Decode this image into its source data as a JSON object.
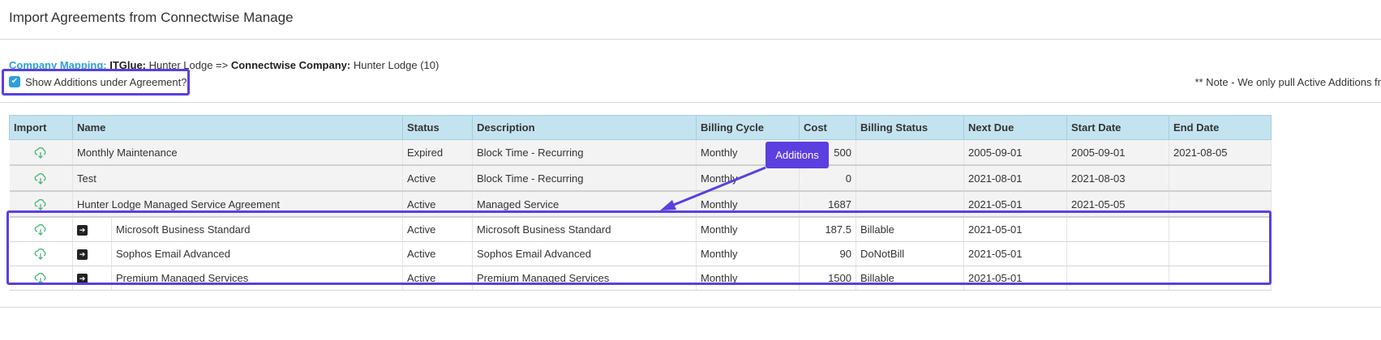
{
  "page": {
    "title": "Import Agreements from Connectwise Manage"
  },
  "mapping": {
    "label": "Company Mapping:",
    "itglue_label": "ITGlue:",
    "itglue_value": "Hunter Lodge =>",
    "cw_label": "Connectwise Company:",
    "cw_value": "Hunter Lodge (10)"
  },
  "options": {
    "show_additions_label": "Show Additions under Agreement?",
    "show_additions_checked": true,
    "note": "** Note - We only pull Active Additions fr"
  },
  "table": {
    "headers": {
      "import": "Import",
      "name": "Name",
      "status": "Status",
      "description": "Description",
      "billing_cycle": "Billing Cycle",
      "cost": "Cost",
      "billing_status": "Billing Status",
      "next_due": "Next Due",
      "start_date": "Start Date",
      "end_date": "End Date"
    },
    "agreements": [
      {
        "name": "Monthly Maintenance",
        "status": "Expired",
        "description": "Block Time - Recurring",
        "billing_cycle": "Monthly",
        "cost": "500",
        "billing_status": "",
        "next_due": "2005-09-01",
        "start_date": "2005-09-01",
        "end_date": "2021-08-05"
      },
      {
        "name": "Test",
        "status": "Active",
        "description": "Block Time - Recurring",
        "billing_cycle": "Monthly",
        "cost": "0",
        "billing_status": "",
        "next_due": "2021-08-01",
        "start_date": "2021-08-03",
        "end_date": ""
      },
      {
        "name": "Hunter Lodge Managed Service Agreement",
        "status": "Active",
        "description": "Managed Service",
        "billing_cycle": "Monthly",
        "cost": "1687",
        "billing_status": "",
        "next_due": "2021-05-01",
        "start_date": "2021-05-05",
        "end_date": ""
      }
    ],
    "additions": [
      {
        "name": "Microsoft Business Standard",
        "status": "Active",
        "description": "Microsoft Business Standard",
        "billing_cycle": "Monthly",
        "cost": "187.5",
        "billing_status": "Billable",
        "next_due": "2021-05-01",
        "start_date": "",
        "end_date": ""
      },
      {
        "name": "Sophos Email Advanced",
        "status": "Active",
        "description": "Sophos Email Advanced",
        "billing_cycle": "Monthly",
        "cost": "90",
        "billing_status": "DoNotBill",
        "next_due": "2021-05-01",
        "start_date": "",
        "end_date": ""
      },
      {
        "name": "Premium Managed Services",
        "status": "Active",
        "description": "Premium Managed Services",
        "billing_cycle": "Monthly",
        "cost": "1500",
        "billing_status": "Billable",
        "next_due": "2021-05-01",
        "start_date": "",
        "end_date": ""
      }
    ]
  },
  "annotation": {
    "callout_label": "Additions",
    "highlight_color": "#5b3fe0"
  },
  "icons": {
    "import": "cloud-download-icon",
    "addition": "arrow-right-box-icon",
    "checkbox": "checkmark-icon"
  },
  "colors": {
    "header_bg": "#c4e3f0",
    "accent_blue": "#2d9fd8",
    "annotation": "#5b3fe0"
  }
}
